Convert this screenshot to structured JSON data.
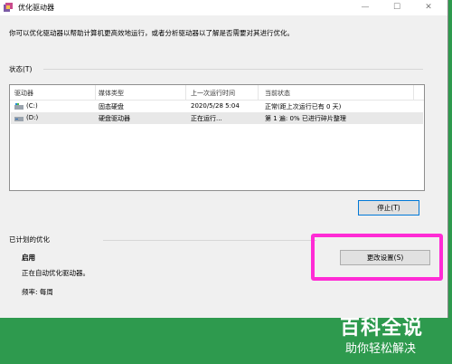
{
  "window": {
    "title": "优化驱动器",
    "min_glyph": "—",
    "max_glyph": "☐",
    "close_glyph": "✕"
  },
  "description": "你可以优化驱动器以帮助计算机更高效地运行，或者分析驱动器以了解是否需要对其进行优化。",
  "status": {
    "label": "状态(T)",
    "columns": [
      "驱动器",
      "媒体类型",
      "上一次运行时间",
      "当前状态"
    ],
    "rows": [
      {
        "drive": "(C:)",
        "media": "固态硬盘",
        "last_run": "2020/5/28 5:04",
        "status": "正常(距上次运行已有 0 天)",
        "icon": "system-drive-icon"
      },
      {
        "drive": "(D:)",
        "media": "硬盘驱动器",
        "last_run": "正在运行...",
        "status": "第 1 遍: 0% 已进行碎片整理",
        "icon": "hard-drive-icon"
      }
    ],
    "stop_button": "停止(T)"
  },
  "scheduled": {
    "label": "已计划的优化",
    "state": "启用",
    "description": "正在自动优化驱动器。",
    "frequency": "频率: 每周",
    "change_button": "更改设置(S)"
  },
  "watermark": {
    "main": "百科全说",
    "sub": "助你轻松解决"
  },
  "colors": {
    "highlight": "#ff2bd5",
    "background_green": "#2e9a4e"
  }
}
